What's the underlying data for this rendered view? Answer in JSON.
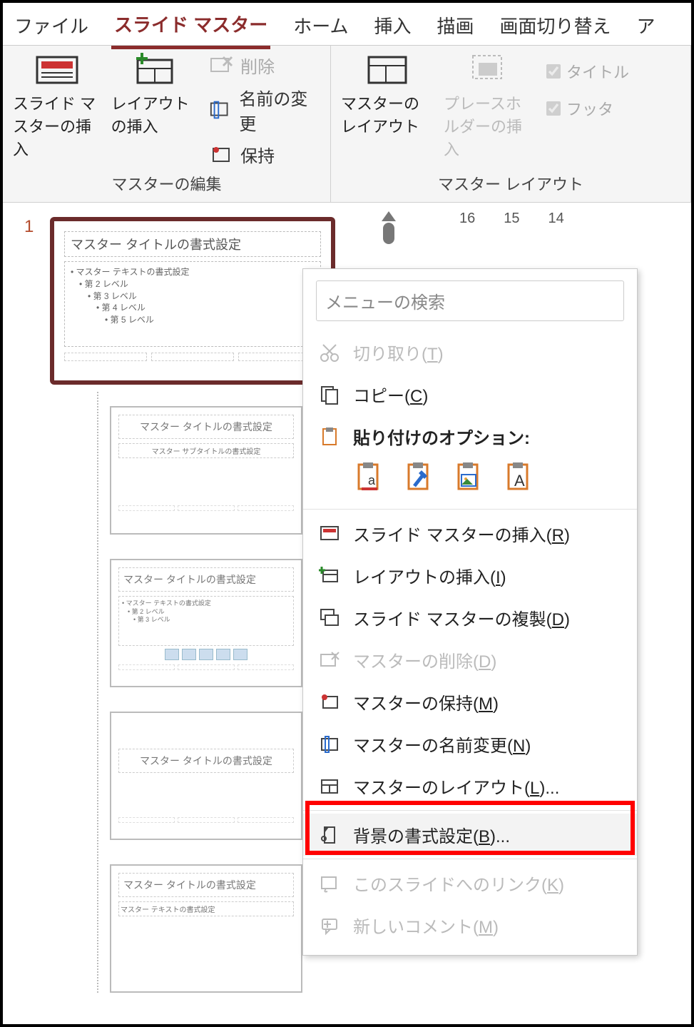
{
  "tabs": {
    "file": "ファイル",
    "slide_master": "スライド マスター",
    "home": "ホーム",
    "insert": "挿入",
    "draw": "描画",
    "transition": "画面切り替え",
    "partial": "ア"
  },
  "ribbon": {
    "group_edit_label": "マスターの編集",
    "insert_master": "スライド マスターの挿入",
    "insert_layout": "レイアウトの挿入",
    "delete": "削除",
    "rename": "名前の変更",
    "preserve": "保持",
    "group_layout_label": "マスター レイアウト",
    "master_layout": "マスターのレイアウト",
    "placeholder_insert": "プレースホルダーの挿入",
    "title_chk": "タイトル",
    "footer_chk": "フッタ"
  },
  "ruler": {
    "n16": "16",
    "n15": "15",
    "n14": "14"
  },
  "thumbs": {
    "index": "1",
    "master_title": "マスター タイトルの書式設定",
    "master_body_l1": "• マスター テキストの書式設定",
    "master_body_l2": "• 第 2 レベル",
    "master_body_l3": "• 第 3 レベル",
    "master_body_l4": "• 第 4 レベル",
    "master_body_l5": "• 第 5 レベル",
    "layout1_title": "マスター タイトルの書式設定",
    "layout1_sub": "マスター サブタイトルの書式設定",
    "layout2_title": "マスター タイトルの書式設定",
    "layout3_title": "マスター タイトルの書式設定",
    "layout4_title": "マスター タイトルの書式設定",
    "layout4_sub": "マスター テキストの書式設定"
  },
  "context_menu": {
    "search_placeholder": "メニューの検索",
    "cut": "切り取り",
    "cut_key": "T",
    "copy": "コピー",
    "copy_key": "C",
    "paste_header": "貼り付けのオプション:",
    "insert_master": "スライド マスターの挿入",
    "insert_master_key": "R",
    "insert_layout": "レイアウトの挿入",
    "insert_layout_key": "I",
    "duplicate_master": "スライド マスターの複製",
    "duplicate_master_key": "D",
    "delete_master": "マスターの削除",
    "delete_master_key": "D",
    "preserve_master": "マスターの保持",
    "preserve_master_key": "M",
    "rename_master": "マスターの名前変更",
    "rename_master_key": "N",
    "master_layout": "マスターのレイアウト",
    "master_layout_key": "L",
    "format_background": "背景の書式設定",
    "format_background_key": "B",
    "link_to_slide": "このスライドへのリンク",
    "link_to_slide_key": "K",
    "new_comment": "新しいコメント",
    "new_comment_key": "M"
  }
}
